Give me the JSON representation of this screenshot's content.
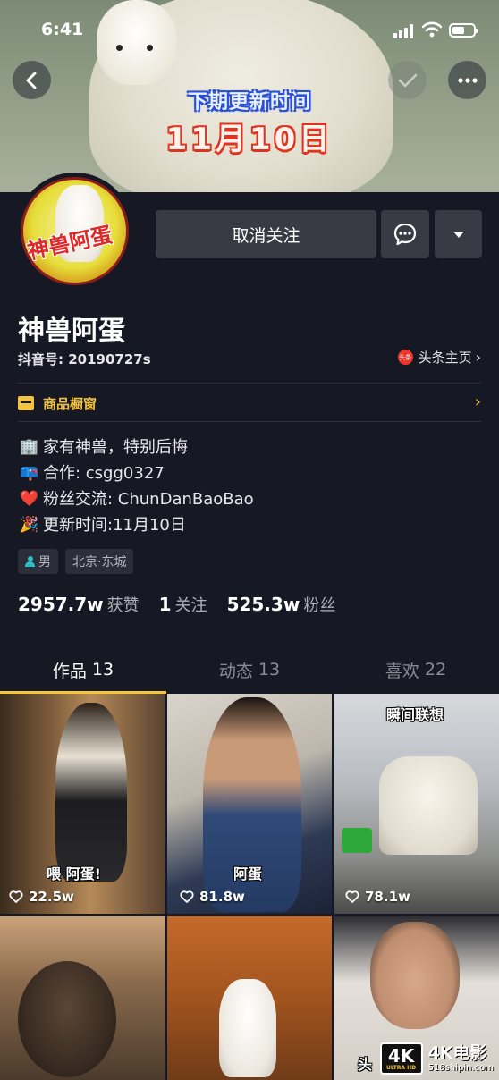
{
  "status_bar": {
    "time": "6:41"
  },
  "banner": {
    "line1": "下期更新时间",
    "line2": "11月10日"
  },
  "profile": {
    "avatar_text": "神兽阿蛋",
    "unfollow_label": "取消关注",
    "nickname": "神兽阿蛋",
    "douyin_id": "抖音号: 20190727s",
    "toutiao_badge": "头条",
    "toutiao_label": "头条主页"
  },
  "shop": {
    "label": "商品橱窗"
  },
  "bio": [
    {
      "icon": "office-building-icon",
      "emoji": "🏢",
      "text": "家有神兽，特别后悔"
    },
    {
      "icon": "mailbox-icon",
      "emoji": "📪",
      "text": "合作: csgg0327"
    },
    {
      "icon": "heart-icon",
      "emoji": "❤️",
      "text": "粉丝交流: ChunDanBaoBao"
    },
    {
      "icon": "party-popper-icon",
      "emoji": "🎉",
      "text": "更新时间:11月10日"
    }
  ],
  "tags": {
    "gender": "男",
    "location": "北京·东城"
  },
  "stats": {
    "likes_num": "2957.7w",
    "likes_label": "获赞",
    "following_num": "1",
    "following_label": "关注",
    "followers_num": "525.3w",
    "followers_label": "粉丝"
  },
  "tabs": [
    {
      "label": "作品",
      "count": "13"
    },
    {
      "label": "动态",
      "count": "13"
    },
    {
      "label": "喜欢",
      "count": "22"
    }
  ],
  "videos": [
    {
      "caption": "喂 阿蛋!",
      "likes": "22.5w"
    },
    {
      "caption": "阿蛋",
      "likes": "81.8w"
    },
    {
      "caption": "瞬间联想",
      "likes": "78.1w"
    },
    {
      "caption": "",
      "likes": ""
    },
    {
      "caption": "",
      "likes": ""
    },
    {
      "caption": "头",
      "likes": ""
    }
  ],
  "watermark": {
    "badge": "4K",
    "badge_sub": "ULTRA HD",
    "title": "4K电影",
    "url": "518shipin.com"
  },
  "colors": {
    "background": "#161823",
    "accent": "#f5c63a",
    "button": "#393b44",
    "toutiao_red": "#f0362c"
  }
}
